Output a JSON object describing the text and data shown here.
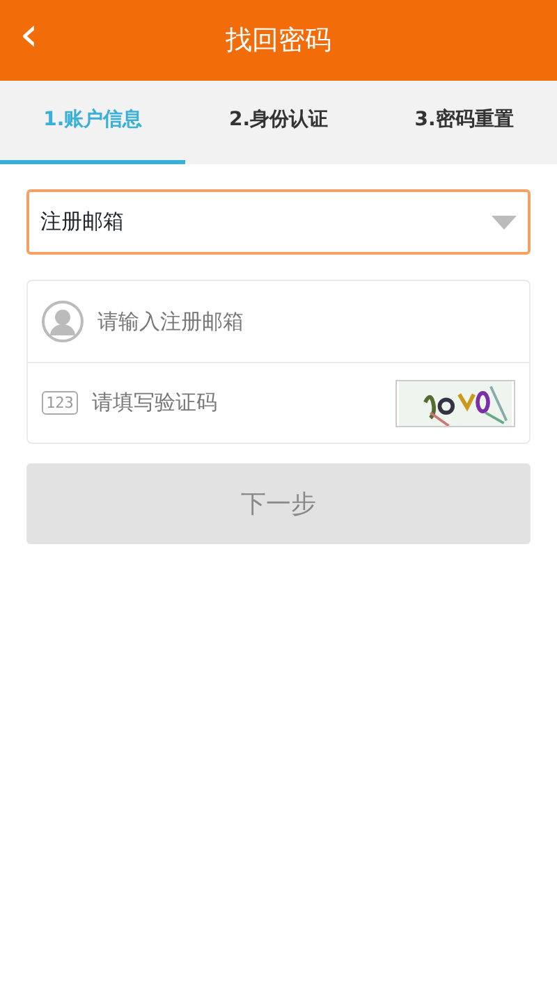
{
  "header": {
    "back_icon": "‹",
    "title": "找回密码"
  },
  "steps": [
    {
      "label": "1.账户信息",
      "selected": true
    },
    {
      "label": "2.身份认证",
      "selected": false
    },
    {
      "label": "3.密码重置",
      "selected": false
    }
  ],
  "account_type": {
    "value": "注册邮箱",
    "focused": true
  },
  "email_field": {
    "placeholder": "请输入注册邮箱"
  },
  "captcha_field": {
    "icon_label": "123",
    "placeholder": "请填写验证码"
  },
  "next_button": {
    "label": "下一步",
    "disabled": true
  }
}
